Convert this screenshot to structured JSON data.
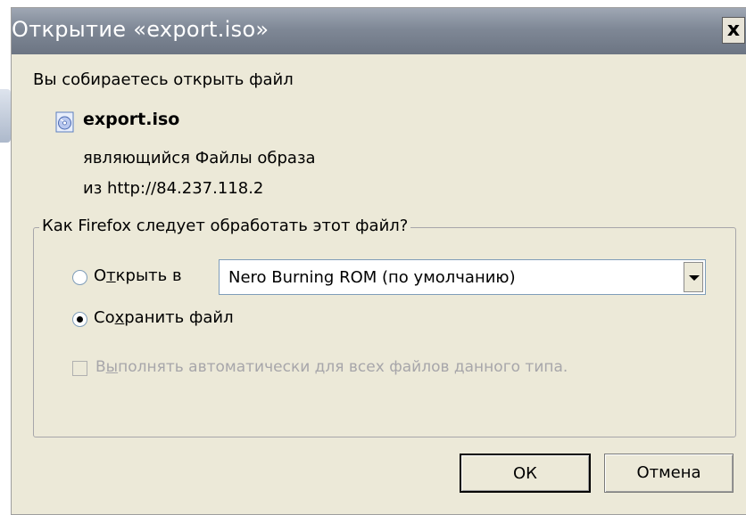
{
  "dialog": {
    "title": "Открытие «export.iso»",
    "close_label": "x",
    "intro": "Вы собираетесь открыть файл",
    "file": {
      "name": "export.iso",
      "type_line": "являющийся  Файлы образа",
      "from_line": "из http://84.237.118.2",
      "icon": "disc-image-file-icon"
    },
    "group": {
      "legend": "Как Firefox следует обработать этот файл?",
      "open_with": {
        "label_pre": "О",
        "label_underline": "т",
        "label_post": "крыть в",
        "selected": false
      },
      "app_select": {
        "value": "Nero Burning ROM (по умолчанию)"
      },
      "save_file": {
        "label_pre": "Со",
        "label_underline": "х",
        "label_post": "ранить файл",
        "selected": true
      },
      "auto_check": {
        "label_pre": "В",
        "label_underline": "ы",
        "label_post": "полнять автоматически для всех файлов данного типа.",
        "checked": false,
        "enabled": false
      }
    },
    "buttons": {
      "ok": "ОК",
      "cancel": "Отмена"
    }
  }
}
